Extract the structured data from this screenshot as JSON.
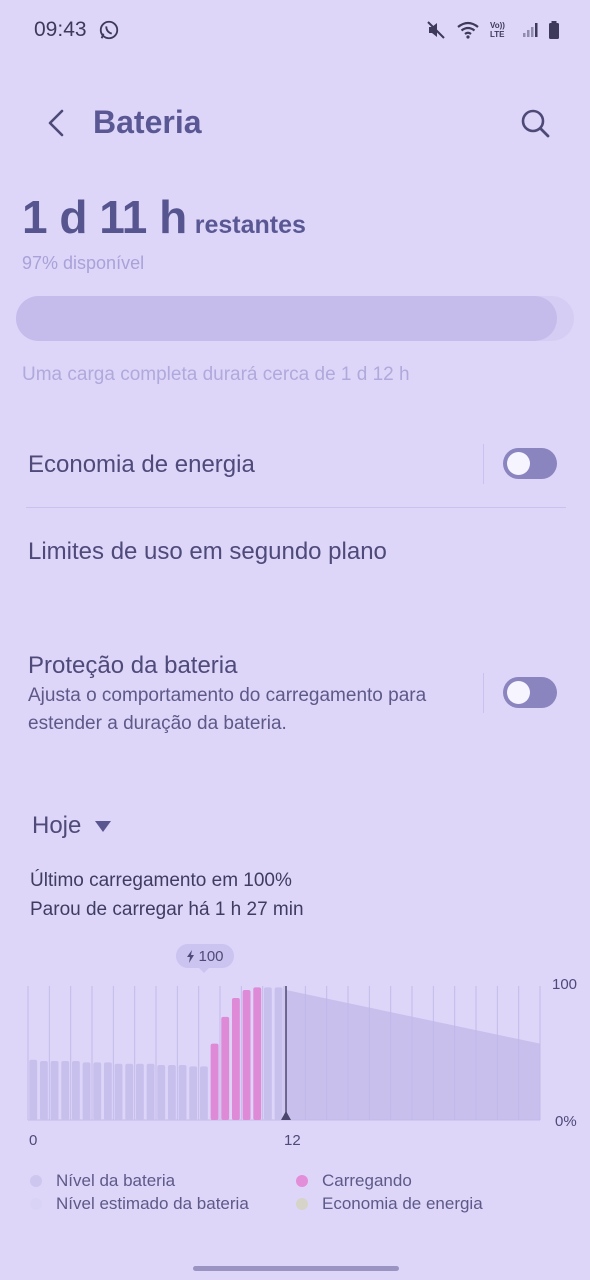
{
  "status_bar": {
    "time": "09:43",
    "signal_label": "Vo)) LTE"
  },
  "header": {
    "title": "Bateria"
  },
  "battery": {
    "remaining_value": "1 d 11 h",
    "remaining_suffix": "restantes",
    "available": "97% disponível",
    "level_fraction": 0.97,
    "full_charge_note": "Uma carga completa durará cerca de 1 d 12 h"
  },
  "settings": {
    "power_saving": {
      "label": "Economia de energia",
      "enabled": false
    },
    "background_limits": {
      "label": "Limites de uso em segundo plano"
    },
    "battery_protection": {
      "label": "Proteção da bateria",
      "description_line1": "Ajusta o comportamento do carregamento para",
      "description_line2": "estender a duração da bateria.",
      "enabled": false
    }
  },
  "usage": {
    "period": "Hoje",
    "last_charge": "Último carregamento em 100%",
    "stopped_charging": "Parou de carregar há 1 h 27 min"
  },
  "chart_data": {
    "type": "bar",
    "y_ticks": {
      "top": "100",
      "bottom": "0%"
    },
    "x_ticks": [
      "0",
      "12"
    ],
    "peak_badge": "100",
    "ylim": [
      0,
      100
    ],
    "history_values": [
      45,
      44,
      44,
      44,
      44,
      43,
      43,
      43,
      42,
      42,
      42,
      42,
      41,
      41,
      41,
      40,
      40,
      57,
      77,
      91,
      97,
      99,
      99,
      99
    ],
    "history_charging": [
      false,
      false,
      false,
      false,
      false,
      false,
      false,
      false,
      false,
      false,
      false,
      false,
      false,
      false,
      false,
      false,
      false,
      true,
      true,
      true,
      true,
      true,
      false,
      false
    ],
    "estimated": {
      "start": 97,
      "end": 57
    },
    "legend": [
      {
        "label": "Nível da bateria",
        "color": "#cdc6ef"
      },
      {
        "label": "Carregando",
        "color": "#e38ed8"
      },
      {
        "label": "Nível estimado da bateria",
        "color": "#d9d3f5"
      },
      {
        "label": "Economia de energia",
        "color": "#d6d4c8"
      }
    ],
    "colors": {
      "level": "#c8c0ec",
      "charging": "#df8ad7",
      "estimated": "#c0b7ea",
      "grid": "#c4bbe9",
      "marker": "#4a466e"
    }
  }
}
